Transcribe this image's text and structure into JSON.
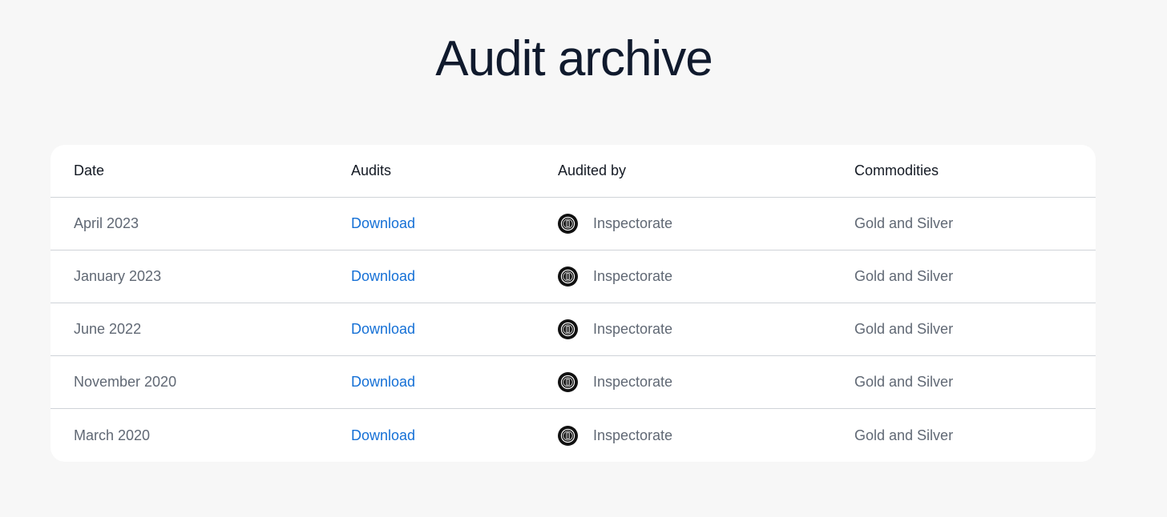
{
  "page": {
    "title": "Audit archive"
  },
  "table": {
    "columns": [
      "Date",
      "Audits",
      "Audited by",
      "Commodities"
    ],
    "rows": [
      {
        "date": "April 2023",
        "audit_link": "Download",
        "auditor": "Inspectorate",
        "auditor_icon": "inspectorate-seal-icon",
        "commodities": "Gold and Silver"
      },
      {
        "date": "January 2023",
        "audit_link": "Download",
        "auditor": "Inspectorate",
        "auditor_icon": "inspectorate-seal-icon",
        "commodities": "Gold and Silver"
      },
      {
        "date": "June 2022",
        "audit_link": "Download",
        "auditor": "Inspectorate",
        "auditor_icon": "inspectorate-seal-icon",
        "commodities": "Gold and Silver"
      },
      {
        "date": "November 2020",
        "audit_link": "Download",
        "auditor": "Inspectorate",
        "auditor_icon": "inspectorate-seal-icon",
        "commodities": "Gold and Silver"
      },
      {
        "date": "March 2020",
        "audit_link": "Download",
        "auditor": "Inspectorate",
        "auditor_icon": "inspectorate-seal-icon",
        "commodities": "Gold and Silver"
      }
    ]
  },
  "colors": {
    "background": "#f7f7f7",
    "card": "#ffffff",
    "title": "#101a2d",
    "link": "#1570d6",
    "body_text": "#606874",
    "divider": "#cfd3d8"
  }
}
